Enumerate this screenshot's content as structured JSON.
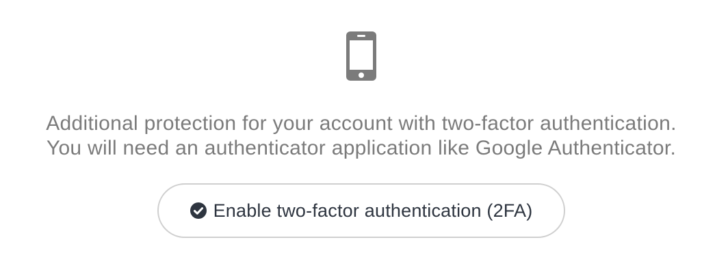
{
  "icons": {
    "top": "smartphone-icon",
    "button": "check-circle-icon"
  },
  "colors": {
    "icon": "#7b7b7b",
    "text": "#7b7b7b",
    "button_text": "#2e3540",
    "button_border": "#cfcfcf"
  },
  "description": {
    "line1": "Additional protection for your account with two-factor authentication.",
    "line2": "You will need an authenticator application like Google Authenticator."
  },
  "button": {
    "label": "Enable two-factor authentication (2FA)"
  }
}
